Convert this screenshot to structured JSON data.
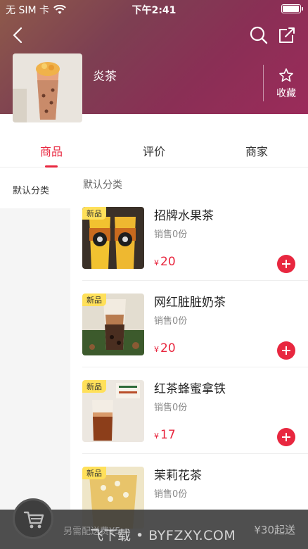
{
  "status_bar": {
    "carrier": "无 SIM 卡",
    "time": "下午2:41",
    "battery_level": 0.9
  },
  "store": {
    "name": "炎茶",
    "favorite_label": "收藏"
  },
  "tabs": [
    {
      "label": "商品",
      "active": true
    },
    {
      "label": "评价",
      "active": false
    },
    {
      "label": "商家",
      "active": false
    }
  ],
  "categories": [
    {
      "label": "默认分类",
      "selected": true
    }
  ],
  "section_title": "默认分类",
  "products": [
    {
      "badge": "新品",
      "name": "招牌水果茶",
      "sales": "销售0份",
      "currency": "¥",
      "price": "20"
    },
    {
      "badge": "新品",
      "name": "网红脏脏奶茶",
      "sales": "销售0份",
      "currency": "¥",
      "price": "20"
    },
    {
      "badge": "新品",
      "name": "红茶蜂蜜拿铁",
      "sales": "销售0份",
      "currency": "¥",
      "price": "17"
    },
    {
      "badge": "新品",
      "name": "茉莉花茶",
      "sales": "销售0份",
      "currency": "¥",
      "price": ""
    }
  ],
  "cart": {
    "note": "另需配送费¥5",
    "min_order": "¥30起送"
  },
  "watermark": "飞下载 • BYFZXY.COM",
  "colors": {
    "accent": "#e8273f",
    "badge": "#ffe05a"
  }
}
